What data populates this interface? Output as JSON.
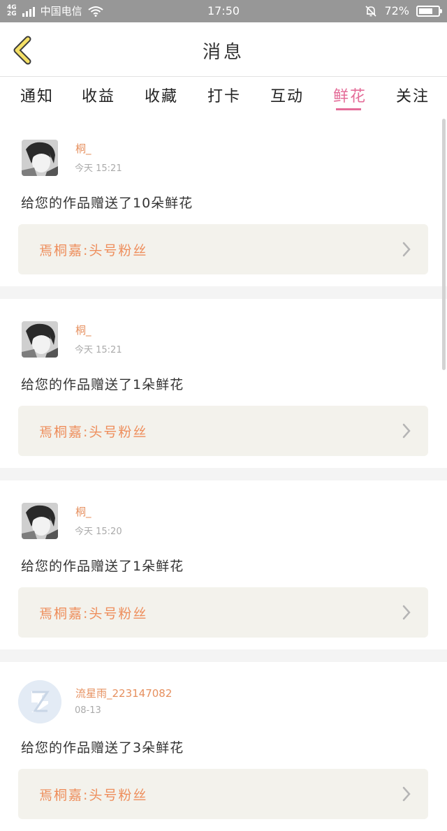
{
  "status_bar": {
    "network_top": "4G",
    "network_bottom": "2G",
    "carrier": "中国电信",
    "time": "17:50",
    "battery": "72%",
    "battery_level": 0.72
  },
  "header": {
    "title": "消息"
  },
  "tabs": [
    {
      "label": "通知"
    },
    {
      "label": "收益"
    },
    {
      "label": "收藏"
    },
    {
      "label": "打卡"
    },
    {
      "label": "互动"
    },
    {
      "label": "鲜花"
    },
    {
      "label": "关注"
    }
  ],
  "active_tab": "鲜花",
  "messages": [
    {
      "user": "桐_",
      "time": "今天 15:21",
      "text": "给您的作品赠送了10朵鲜花",
      "fan_label": "焉桐嘉:头号粉丝"
    },
    {
      "user": "桐_",
      "time": "今天 15:21",
      "text": "给您的作品赠送了1朵鲜花",
      "fan_label": "焉桐嘉:头号粉丝"
    },
    {
      "user": "桐_",
      "time": "今天 15:20",
      "text": "给您的作品赠送了1朵鲜花",
      "fan_label": "焉桐嘉:头号粉丝"
    },
    {
      "user": "流星雨_223147082",
      "time": "08-13",
      "text": "给您的作品赠送了3朵鲜花",
      "fan_label": "焉桐嘉:头号粉丝"
    }
  ],
  "colors": {
    "accent": "#e46c98",
    "username": "#e6905f",
    "fan_text": "#ee8e5c",
    "fan_box": "#f3f2ec",
    "back_arrow": "#f5e066"
  }
}
